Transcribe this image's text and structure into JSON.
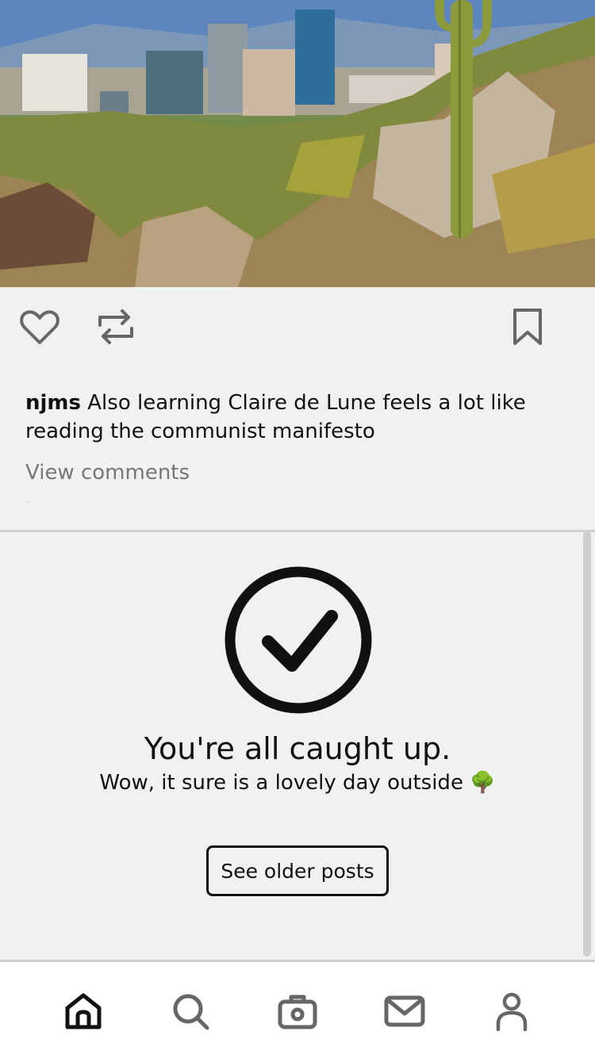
{
  "post": {
    "image_alt": "Desert mountainside with saguaro cactus overlooking a city skyline",
    "username": "njms",
    "caption": "Also learning Claire de Lune feels a lot like reading the communist manifesto",
    "view_comments_label": "View comments",
    "timestamp": "..."
  },
  "actions": {
    "like_icon": "heart-icon",
    "repost_icon": "repost-icon",
    "bookmark_icon": "bookmark-icon"
  },
  "caught_up": {
    "title": "You're all caught up.",
    "subtitle": "Wow, it sure is a lovely day outside 🌳",
    "button_label": "See older posts"
  },
  "nav": {
    "items": [
      {
        "name": "home",
        "icon": "home-icon",
        "active": true
      },
      {
        "name": "search",
        "icon": "search-icon",
        "active": false
      },
      {
        "name": "camera",
        "icon": "camera-icon",
        "active": false
      },
      {
        "name": "messages",
        "icon": "mail-icon",
        "active": false
      },
      {
        "name": "profile",
        "icon": "profile-icon",
        "active": false
      }
    ]
  },
  "colors": {
    "background": "#f1f1f1",
    "text": "#111111",
    "muted": "#777777",
    "icon_inactive": "#666666",
    "nav_background": "#ffffff"
  }
}
